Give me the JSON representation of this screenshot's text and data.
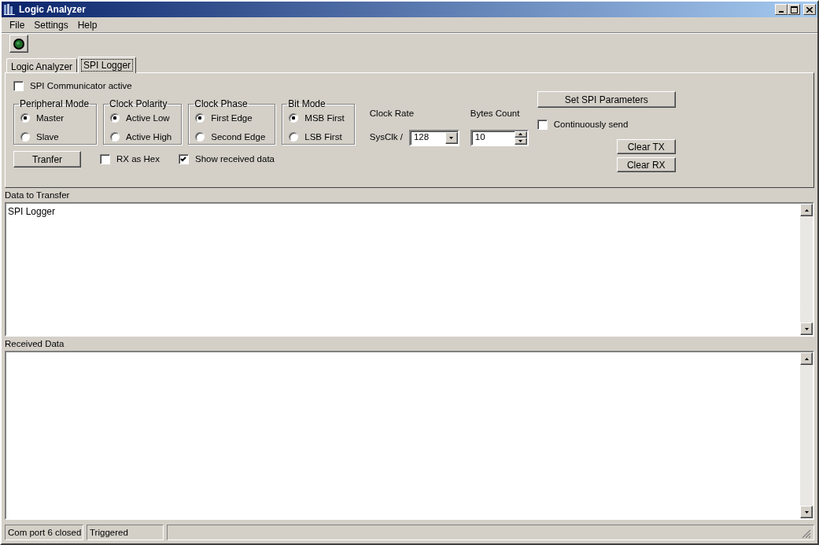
{
  "window": {
    "title": "Logic Analyzer"
  },
  "menu": [
    {
      "label": "File"
    },
    {
      "label": "Settings"
    },
    {
      "label": "Help"
    }
  ],
  "tabs": [
    {
      "label": "Logic Analyzer",
      "selected": false
    },
    {
      "label": "SPI Logger",
      "selected": true
    }
  ],
  "spi_active": {
    "label": "SPI Communicator active",
    "checked": false
  },
  "groups": [
    {
      "title": "Peripheral Mode",
      "options": [
        {
          "label": "Master",
          "selected": true
        },
        {
          "label": "Slave",
          "selected": false
        }
      ]
    },
    {
      "title": "Clock Polarity",
      "options": [
        {
          "label": "Active Low",
          "selected": true
        },
        {
          "label": "Active High",
          "selected": false
        }
      ]
    },
    {
      "title": "Clock Phase",
      "options": [
        {
          "label": "First Edge",
          "selected": true
        },
        {
          "label": "Second Edge",
          "selected": false
        }
      ]
    },
    {
      "title": "Bit Mode",
      "options": [
        {
          "label": "MSB First",
          "selected": true
        },
        {
          "label": "LSB First",
          "selected": false
        }
      ]
    }
  ],
  "transfer_button": "Tranfer",
  "options": [
    {
      "label": "RX as Hex",
      "checked": false
    },
    {
      "label": "Show received data",
      "checked": true
    }
  ],
  "clock_rate": {
    "label": "Clock Rate",
    "prefix": "SysClk /",
    "value": "128"
  },
  "bytes_count": {
    "label": "Bytes Count",
    "value": "10"
  },
  "set_button": "Set SPI Parameters",
  "continuous": {
    "label": "Continuously send",
    "checked": false
  },
  "clear_buttons": [
    "Clear TX",
    "Clear RX"
  ],
  "tx": {
    "label": "Data to Transfer",
    "value": "SPI Logger"
  },
  "rx": {
    "label": "Received Data"
  },
  "status_bar": [
    "Com port 6 closed",
    "Triggered"
  ]
}
